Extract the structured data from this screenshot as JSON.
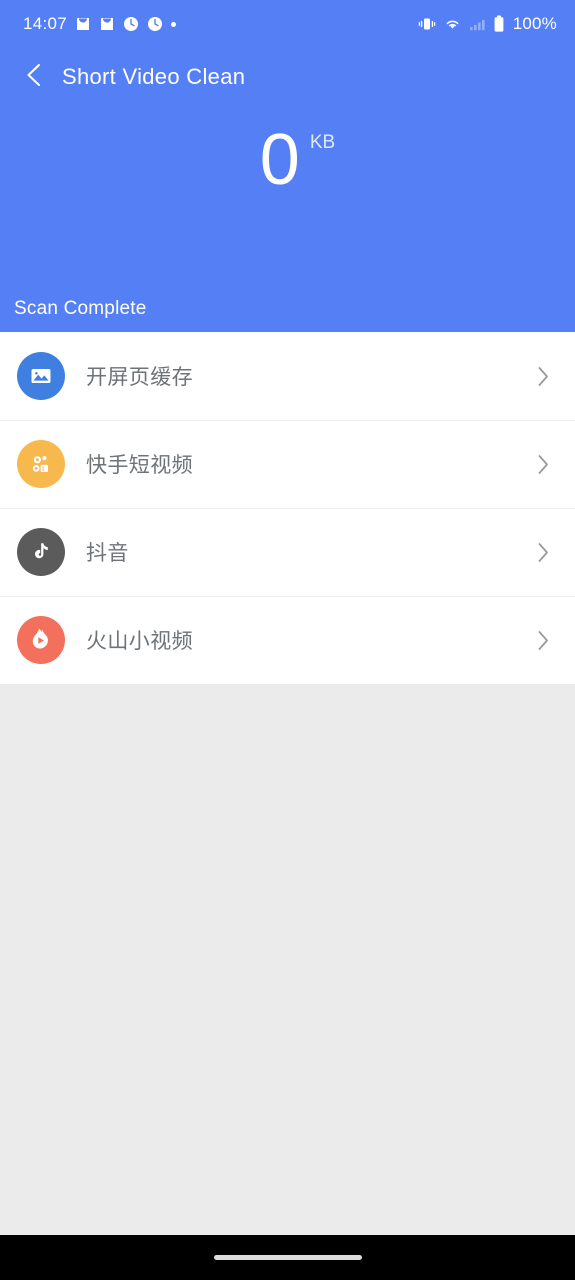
{
  "status_bar": {
    "time": "14:07",
    "battery_text": "100%",
    "left_icons": [
      {
        "name": "mail-icon",
        "glyph": "envelope"
      },
      {
        "name": "mail-icon-2",
        "glyph": "envelope"
      },
      {
        "name": "alarm-clock-icon",
        "glyph": "clock"
      },
      {
        "name": "alarm-clock-icon-2",
        "glyph": "clock"
      },
      {
        "name": "notification-dot-icon",
        "glyph": "dot"
      }
    ],
    "right_icons": [
      {
        "name": "vibrate-icon",
        "glyph": "vibrate"
      },
      {
        "name": "wifi-icon",
        "glyph": "wifi"
      },
      {
        "name": "cellular-signal-icon",
        "glyph": "signal-bars"
      },
      {
        "name": "battery-icon",
        "glyph": "battery-full"
      }
    ]
  },
  "header": {
    "back_icon": "chevron-left-icon",
    "title": "Short Video Clean",
    "size_value": "0",
    "size_unit": "KB",
    "scan_status": "Scan Complete",
    "background_color": "#5580f5"
  },
  "list": {
    "chevron_icon": "chevron-right-icon",
    "items": [
      {
        "label": "开屏页缓存",
        "icon_name": "splash-cache-image-icon",
        "icon_color": "#3e7fe0"
      },
      {
        "label": "快手短视频",
        "icon_name": "kuaishou-camera-icon",
        "icon_color": "#f7b84d"
      },
      {
        "label": "抖音",
        "icon_name": "douyin-music-note-icon",
        "icon_color": "#5b5b5b"
      },
      {
        "label": "火山小视频",
        "icon_name": "huoshan-flame-play-icon",
        "icon_color": "#f2705c"
      }
    ]
  },
  "nav_bar": {
    "home_indicator": "home-gesture-pill"
  }
}
